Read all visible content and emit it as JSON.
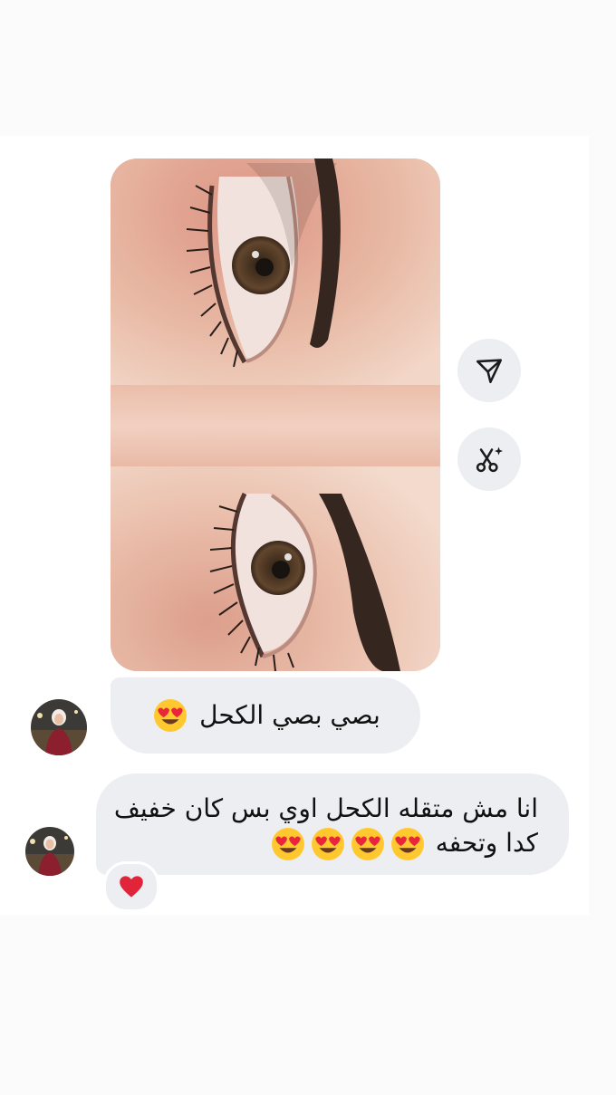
{
  "shared_photo": {
    "subject": "eyes-kohl-closeup"
  },
  "actions": [
    {
      "icon": "send-icon"
    },
    {
      "icon": "magic-cut-icon"
    }
  ],
  "messages": [
    {
      "text": "بصي بصي الكحل",
      "emoji": "😍",
      "emoji_count": 1
    },
    {
      "line1": "انا مش متقله الكحل اوي بس كان خفيف",
      "line2": "كدا وتحفه",
      "emoji": "😍",
      "emoji_count": 4,
      "reaction": "❤️"
    }
  ],
  "colors": {
    "bubble_bg": "#eceef2",
    "heart": "#e0243a",
    "emoji_face": "#ffc82e"
  }
}
